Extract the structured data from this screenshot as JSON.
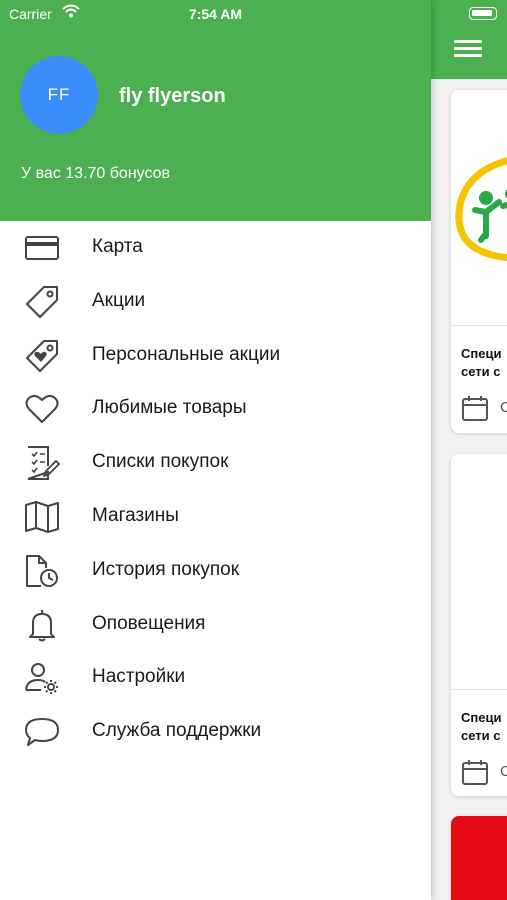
{
  "status_bar": {
    "carrier": "Carrier",
    "time": "7:54 AM"
  },
  "user": {
    "initials": "FF",
    "name": "fly flyerson",
    "bonus_text": "У вас 13.70 бонусов"
  },
  "colors": {
    "brand_green": "#4caf50",
    "avatar_blue": "#3c8dfa",
    "promo_red": "#e50914"
  },
  "menu": {
    "items": [
      {
        "label": "Карта",
        "icon": "card-icon"
      },
      {
        "label": "Акции",
        "icon": "tag-icon"
      },
      {
        "label": "Персональные акции",
        "icon": "heart-tag-icon"
      },
      {
        "label": "Любимые товары",
        "icon": "heart-icon"
      },
      {
        "label": "Списки покупок",
        "icon": "checklist-icon"
      },
      {
        "label": "Магазины",
        "icon": "map-icon"
      },
      {
        "label": "История покупок",
        "icon": "history-icon"
      },
      {
        "label": "Оповещения",
        "icon": "bell-icon"
      },
      {
        "label": "Настройки",
        "icon": "user-settings-icon"
      },
      {
        "label": "Служба поддержки",
        "icon": "chat-bubble-icon"
      }
    ]
  },
  "background_cards": [
    {
      "title_line1": "Специ",
      "title_line2": "сети с",
      "date_prefix": "С"
    },
    {
      "title_line1": "Специ",
      "title_line2": "сети с",
      "date_prefix": "С"
    }
  ]
}
